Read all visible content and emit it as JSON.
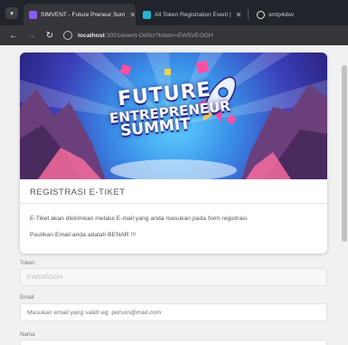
{
  "browser": {
    "tabs": [
      {
        "title": "SIMVENT - Future Preneur Sum",
        "active": true,
        "favicon_color": "#8a5cf6"
      },
      {
        "title": "All Token Registration Event |",
        "active": false,
        "favicon_color": "#23b5d3"
      },
      {
        "title": "smtp4dev",
        "active": false,
        "favicon_color": "#e8eaed"
      }
    ],
    "url_host": "localhost",
    "url_rest": ":3001/event-Od0cr?token=EW5VEOGH"
  },
  "banner": {
    "line1": "FUTURE",
    "line2": "ENTREPRENEUR",
    "line3": "SUMMIT"
  },
  "card": {
    "title": "REGISTRASI E-TIKET",
    "line1": "E-Tiket akan dikirimkan melalui E-mail yang anda masukan pada form registrasi",
    "line2": "Pastikan Email anda adalah BENAR !!!"
  },
  "form": {
    "token_label": "Token",
    "token_value": "EW5VEOGH",
    "email_label": "Email",
    "email_placeholder": "Masukan email yang valid! eg: person@mail.com",
    "name_label": "Nama"
  }
}
